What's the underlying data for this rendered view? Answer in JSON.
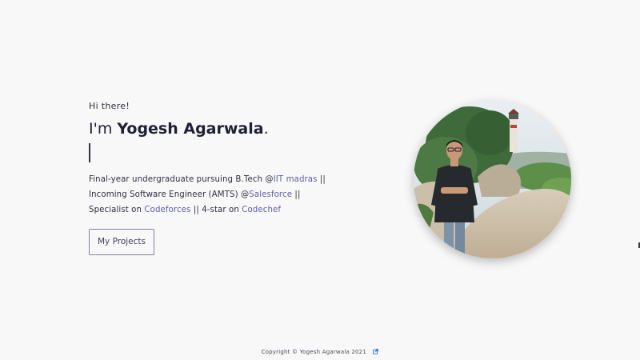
{
  "hero": {
    "greeting": "Hi there!",
    "heading_prefix": "I'm ",
    "name": "Yogesh Agarwala",
    "heading_suffix": ".",
    "bio": {
      "line1_text": "Final-year undergraduate pursuing B.Tech @",
      "line1_link": "IIT madras",
      "line1_end": " ||",
      "line2_text": "Incoming Software Engineer (AMTS) @",
      "line2_link": "Salesforce",
      "line2_end": " ||",
      "line3_text": "Specialist on ",
      "line3_link1": "Codeforces",
      "line3_mid": " || 4-star on ",
      "line3_link2": "Codechef"
    },
    "cta_label": "My Projects"
  },
  "profile_photo": {
    "icon": "profile-photo"
  },
  "footer": {
    "copyright": "Copyright © Yogesh Agarwala 2021",
    "link_icon": "external-link-icon"
  },
  "colors": {
    "background": "#f8f8f9",
    "link": "#5c5ea8",
    "heading": "#1f1f35",
    "button_border": "#8080a8",
    "footer_icon": "#3b7dd8"
  }
}
